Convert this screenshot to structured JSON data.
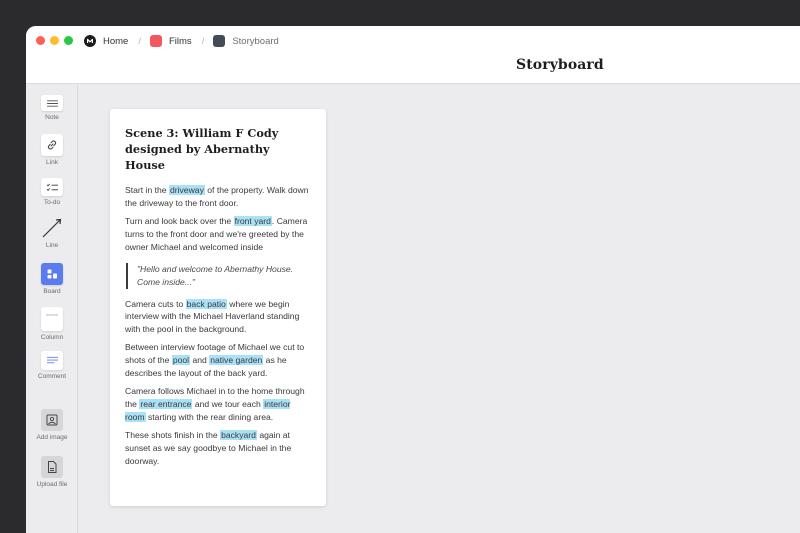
{
  "breadcrumb": {
    "home": "Home",
    "films": "Films",
    "current": "Storyboard",
    "separator": "/"
  },
  "page_title": "Storyboard",
  "colors": {
    "films_icon": "#f25760",
    "storyboard_icon": "#454a57",
    "board_tool": "#5a7cf0",
    "highlight": "#a9e2f6"
  },
  "sidebar": {
    "tools": [
      {
        "label": "Note",
        "icon": "note-icon"
      },
      {
        "label": "Link",
        "icon": "link-icon"
      },
      {
        "label": "To-do",
        "icon": "todo-icon"
      },
      {
        "label": "Line",
        "icon": "line-icon"
      },
      {
        "label": "Board",
        "icon": "board-icon"
      },
      {
        "label": "Column",
        "icon": "column-icon"
      },
      {
        "label": "Comment",
        "icon": "comment-icon"
      },
      {
        "label": "Add image",
        "icon": "image-icon"
      },
      {
        "label": "Upload file",
        "icon": "file-icon"
      }
    ]
  },
  "card": {
    "title": "Scene 3: William F Cody designed by Abernathy House",
    "p1": {
      "a": "Start in the ",
      "h1": "driveway",
      "b": " of the property. Walk down the driveway to the front door."
    },
    "p2": {
      "a": "Turn and look back over the ",
      "h1": "front yard",
      "b": ". Camera turns to the front door and we're greeted by the owner Michael and welcomed inside"
    },
    "quote": "\"Hello and welcome to Abernathy House. Come inside...\"",
    "p3": {
      "a": "Camera cuts to ",
      "h1": "back patio",
      "b": " where we begin interview with the Michael Haverland standing with the pool in the background."
    },
    "p4": {
      "a": "Between interview footage of Michael we cut to shots of the ",
      "h1": "pool",
      "b": " and ",
      "h2": "native garden",
      "c": " as he describes the layout of the back yard."
    },
    "p5": {
      "a": "Camera follows Michael in to the home through the ",
      "h1": "rear entrance",
      "b": " and we tour each ",
      "h2": "interior room",
      "c": " starting with the rear dining area."
    },
    "p6": {
      "a": "These shots finish in the ",
      "h1": "backyard",
      "b": " again at sunset as we say goodbye to Michael in the doorway."
    }
  }
}
